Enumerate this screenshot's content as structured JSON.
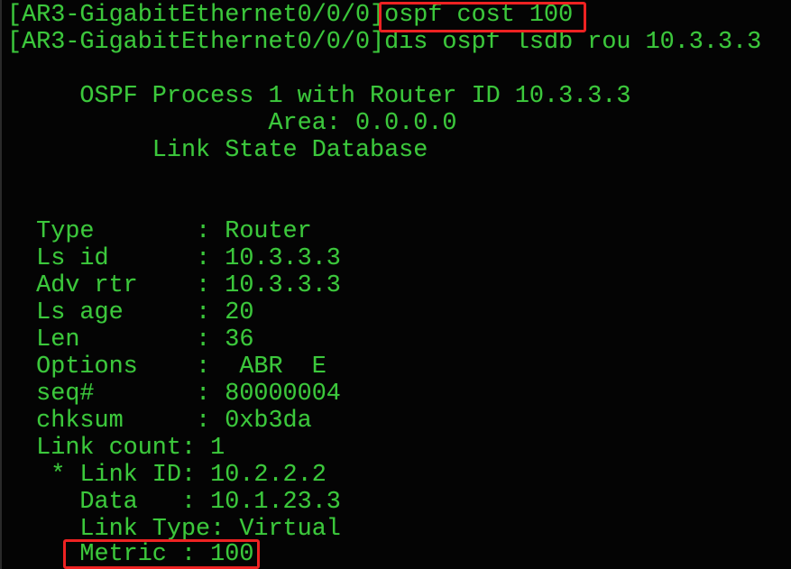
{
  "terminal": {
    "prompt": "[AR3-GigabitEthernet0/0/0]",
    "commands": [
      "ospf cost 100",
      "dis ospf lsdb rou 10.3.3.3"
    ],
    "header": {
      "process_line": "     OSPF Process 1 with Router ID 10.3.3.3",
      "area_line": "                  Area: 0.0.0.0",
      "title_line": "          Link State Database"
    },
    "lsa_fields": [
      {
        "label": "  Type       ",
        "sep": ": ",
        "value": "Router"
      },
      {
        "label": "  Ls id      ",
        "sep": ": ",
        "value": "10.3.3.3"
      },
      {
        "label": "  Adv rtr    ",
        "sep": ": ",
        "value": "10.3.3.3"
      },
      {
        "label": "  Ls age     ",
        "sep": ": ",
        "value": "20"
      },
      {
        "label": "  Len        ",
        "sep": ": ",
        "value": "36"
      },
      {
        "label": "  Options    ",
        "sep": ":  ",
        "value": "ABR  E"
      },
      {
        "label": "  seq#       ",
        "sep": ": ",
        "value": "80000004"
      },
      {
        "label": "  chksum     ",
        "sep": ": ",
        "value": "0xb3da"
      },
      {
        "label": "  Link count",
        "sep": ": ",
        "value": "1"
      }
    ],
    "links": [
      {
        "link_id_label": "   * Link ID",
        "link_id_sep": ": ",
        "link_id": "10.2.2.2",
        "data_label": "     Data   ",
        "data_sep": ": ",
        "data": "10.1.23.3",
        "type_label": "     Link Type",
        "type_sep": ": ",
        "type": "Virtual",
        "metric_label": "     Metric ",
        "metric_sep": ": ",
        "metric": "100"
      }
    ]
  },
  "highlights": {
    "color": "#ee2222",
    "targets": [
      "ospf cost 100",
      "Metric : 100"
    ]
  },
  "colors": {
    "background": "#040404",
    "text": "#3cc83c"
  }
}
